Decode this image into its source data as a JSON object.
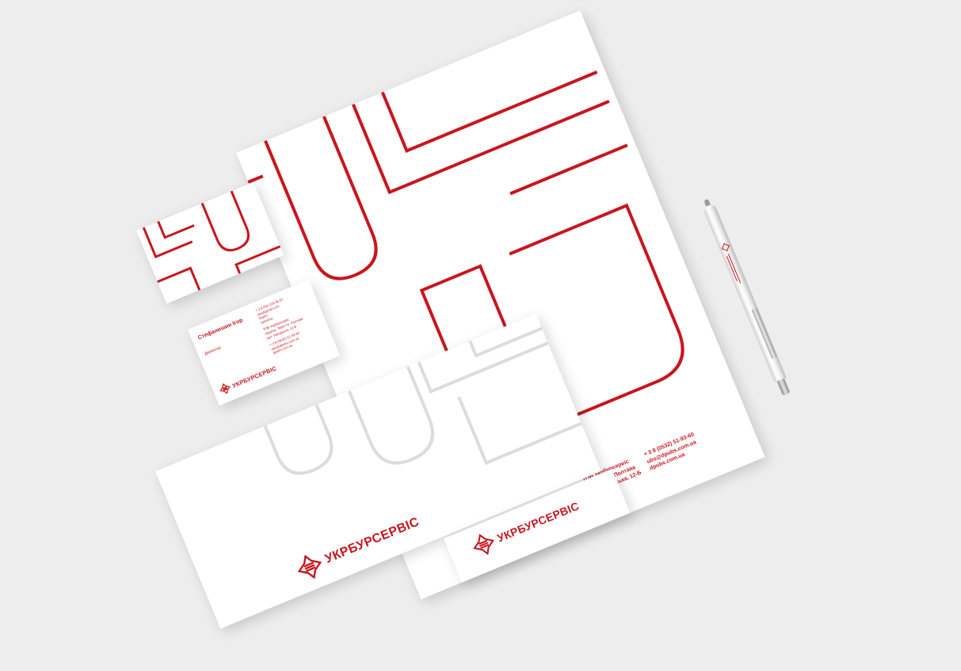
{
  "brand": {
    "name": "УКРБУРСЕРВІС",
    "color": "#c8161d",
    "icon": "ornament-logo-icon"
  },
  "business_card": {
    "name": "Стефанишин Ігор",
    "role": "Директор",
    "phone": "+ 3 8 050 123-45-67",
    "email": "ubs@gmail.com",
    "skype_label": "Skype:",
    "skype": "JohnDoe",
    "company": "ТОВ Укрбурсервіс",
    "address_line1": "Україна, 36007 м. Полтава",
    "address_line2": "вул. Заводська, 12-Б",
    "office_phone": "+ 3 8 (0532) 51-93-60",
    "office_email": "ubs@dpubs.com.ua",
    "website": "dpubs.com.ua"
  },
  "letterhead": {
    "company": "ТОВ Укрбурсервіс",
    "address_line1": "Україна, м. Полтава",
    "address_line2": "вул. Заводська, 12-Б",
    "phone": "+ 3 8 (0532) 51-93-60",
    "email": "ubs@dpubs.com.ua",
    "website": "dpubs.com.ua"
  },
  "envelope": {
    "brand": "УКРБУРСЕРВІС"
  },
  "small_envelope": {
    "brand": "УКРБУРСЕРВІС"
  }
}
